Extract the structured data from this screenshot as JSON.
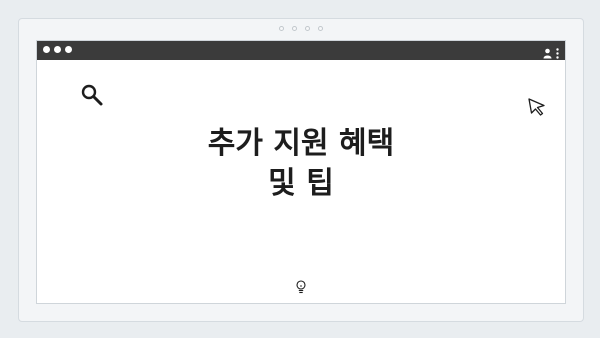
{
  "slide": {
    "title_line1": "추가 지원 혜택",
    "title_line2": "및 팁"
  },
  "icons": {
    "search": "search-icon",
    "cursor": "cursor-arrow-icon",
    "bulb": "lightbulb-icon",
    "user": "user-icon",
    "menu": "kebab-menu-icon"
  },
  "colors": {
    "titlebar": "#3b3b3b",
    "background": "#e9edf0",
    "window": "#ffffff",
    "text": "#1d1d1d"
  },
  "pager": {
    "count": 4
  }
}
